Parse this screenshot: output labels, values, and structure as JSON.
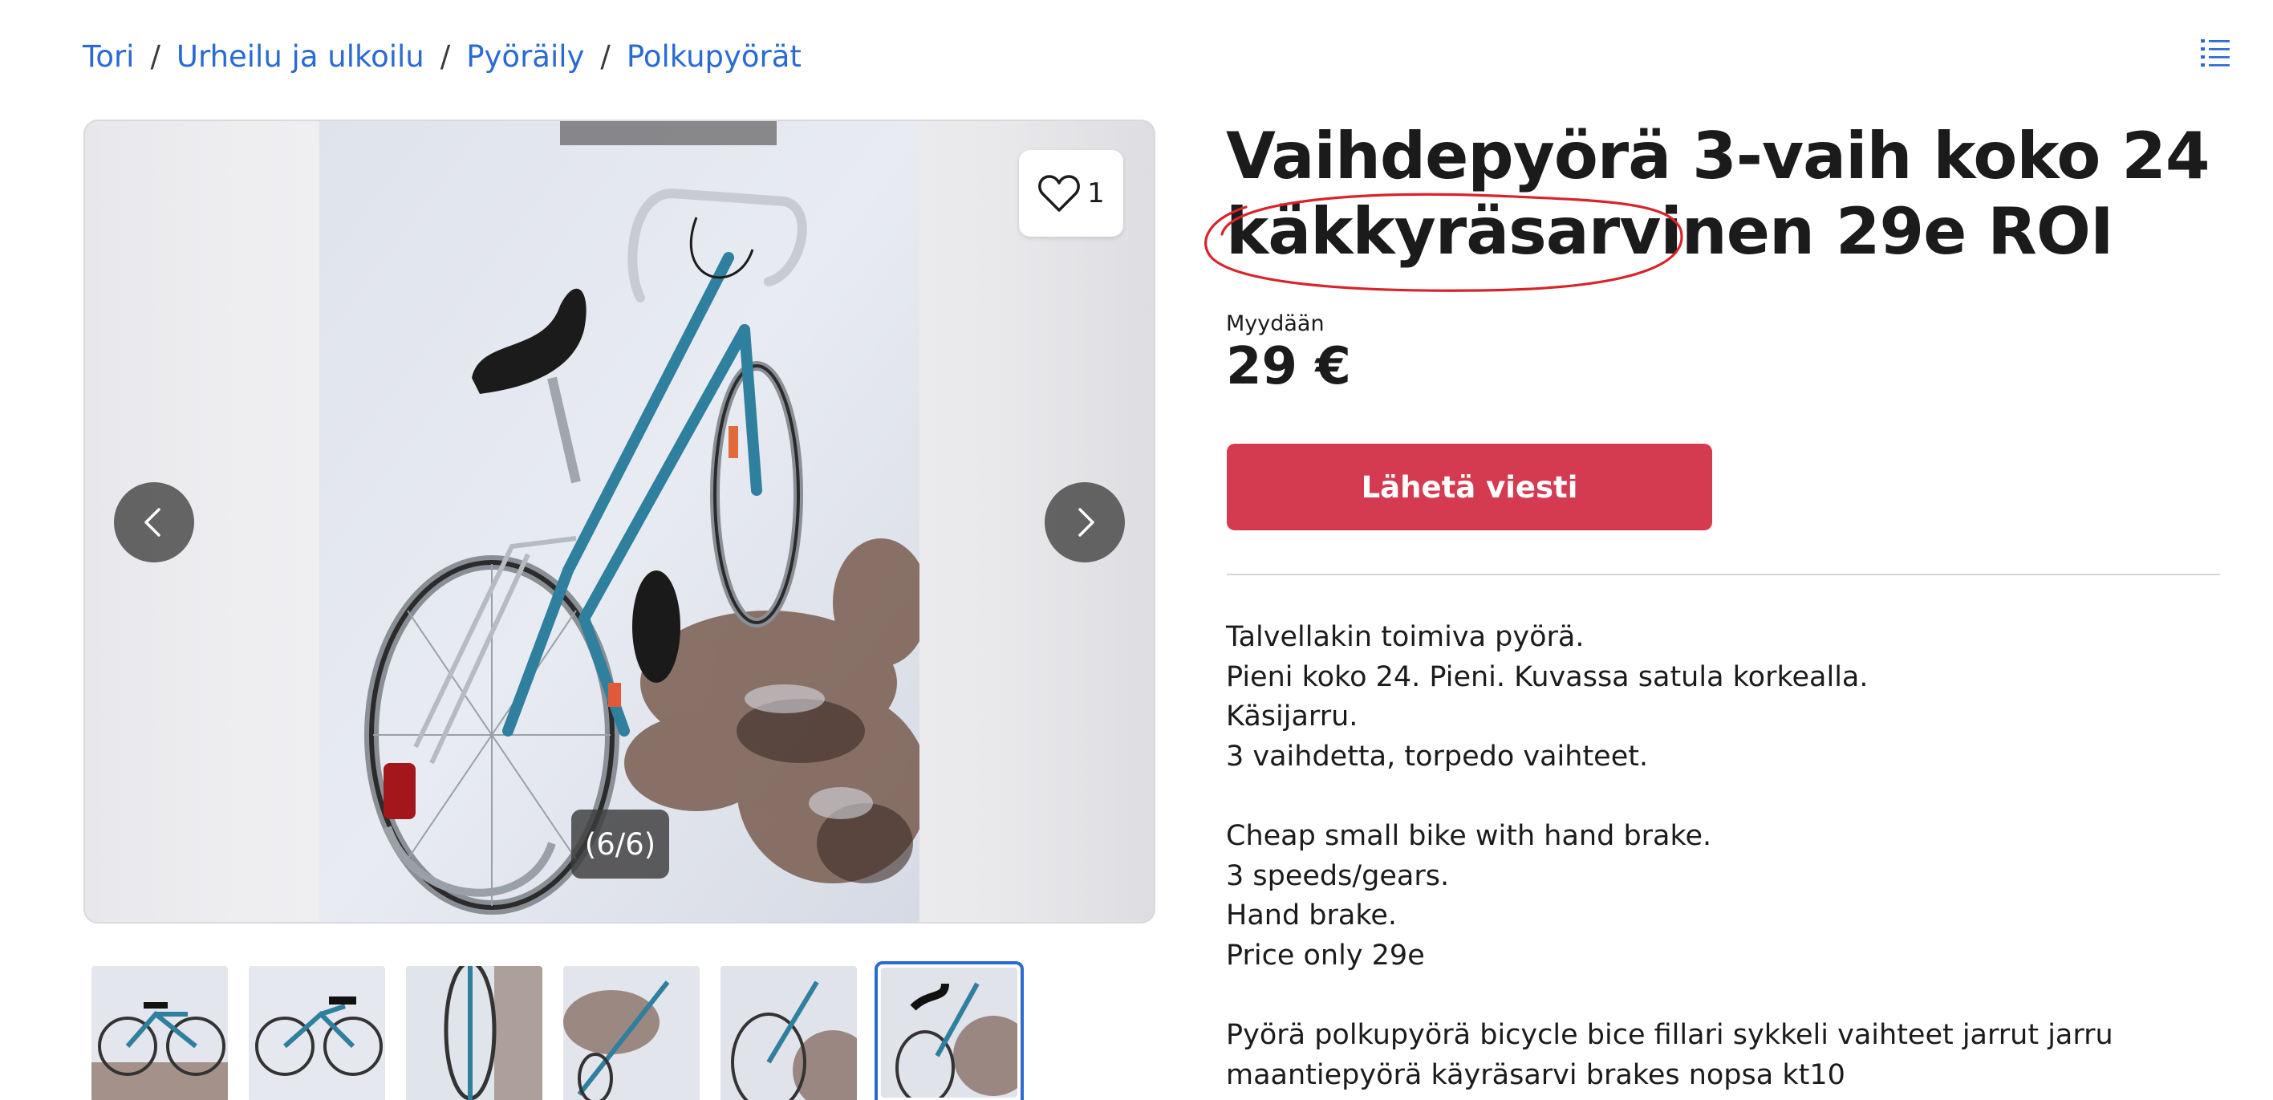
{
  "breadcrumb": {
    "items": [
      "Tori",
      "Urheilu ja ulkoilu",
      "Pyöräily",
      "Polkupyörät"
    ],
    "separator": "/"
  },
  "header": {
    "menu_icon": "list-icon"
  },
  "gallery": {
    "favorite_count": "1",
    "counter": "(6/6)",
    "thumbnail_count": 6,
    "selected_thumbnail": 6
  },
  "listing": {
    "title_line1": "Vaihdepyörä 3-vaih koko 24",
    "title_circled": "käkkyräsarvinen",
    "title_rest": " 29e ROI",
    "sale_type": "Myydään",
    "price": "29 €",
    "send_button": "Lähetä viesti",
    "description": [
      "Talvellakin toimiva pyörä.",
      "Pieni koko 24. Pieni. Kuvassa satula korkealla.",
      "Käsijarru.",
      "3 vaihdetta, torpedo vaihteet.",
      "",
      "Cheap small bike with hand brake.",
      "3 speeds/gears.",
      "Hand brake.",
      "Price only 29e",
      "",
      "Pyörä polkupyörä bicycle bice fillari sykkeli vaihteet jarrut jarru",
      "maantiepyörä käyräsarvi brakes nopsa kt10"
    ]
  },
  "colors": {
    "link": "#2a6ad2",
    "cta": "#d43b51",
    "annotation": "#d8232a",
    "text": "#1b1b1b"
  }
}
